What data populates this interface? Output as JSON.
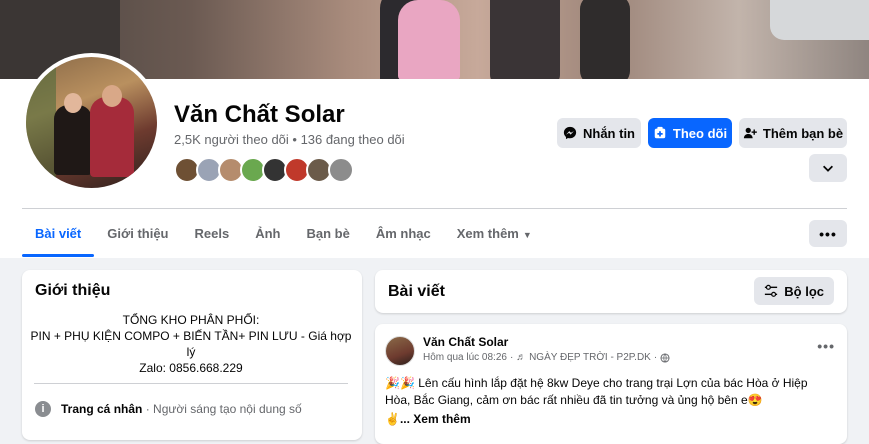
{
  "page": {
    "name": "Văn Chất Solar",
    "followers": "2,5K người theo dõi • 136 đang theo dõi"
  },
  "actions": {
    "message": "Nhắn tin",
    "follow": "Theo dõi",
    "add_friend": "Thêm bạn bè"
  },
  "tabs": [
    {
      "label": "Bài viết"
    },
    {
      "label": "Giới thiệu"
    },
    {
      "label": "Reels"
    },
    {
      "label": "Ảnh"
    },
    {
      "label": "Bạn bè"
    },
    {
      "label": "Âm nhạc"
    },
    {
      "label": "Xem thêm"
    }
  ],
  "friends_strip": [
    "#6e5034",
    "#9aa3b5",
    "#b58c6d",
    "#6aa84f",
    "#333333",
    "#c0392b",
    "#6b5b4a",
    "#8c8c8c"
  ],
  "intro": {
    "title": "Giới thiệu",
    "bio_line1": "TỔNG KHO PHÂN PHỐI:",
    "bio_line2": "PIN + PHỤ KIỆN COMPO + BIẾN TẦN+ PIN LƯU - Giá hợp lý",
    "bio_line3": "Zalo: 0856.668.229",
    "info_label": "Trang cá nhân",
    "info_value": " · Người sáng tạo nội dung số"
  },
  "posts": {
    "title": "Bài viết",
    "filter_label": "Bộ lọc",
    "first": {
      "author": "Văn Chất Solar",
      "time": "Hôm qua lúc 08:26",
      "music": "♬ NGÀY ĐẸP TRỜI - P2P.DK",
      "text": "🎉🎉 Lên cấu hình lắp đặt hệ 8kw Deye cho trang trại Lợn của bác Hòa ở Hiệp Hòa, Bắc Giang, cảm ơn bác rất nhiều đã tin tưởng và ủng hộ bên e😍",
      "see_more": "✌️... Xem thêm"
    }
  },
  "colors": {
    "accent": "#0866ff",
    "secondary_bg": "#e4e6eb",
    "muted_text": "#65676b"
  }
}
